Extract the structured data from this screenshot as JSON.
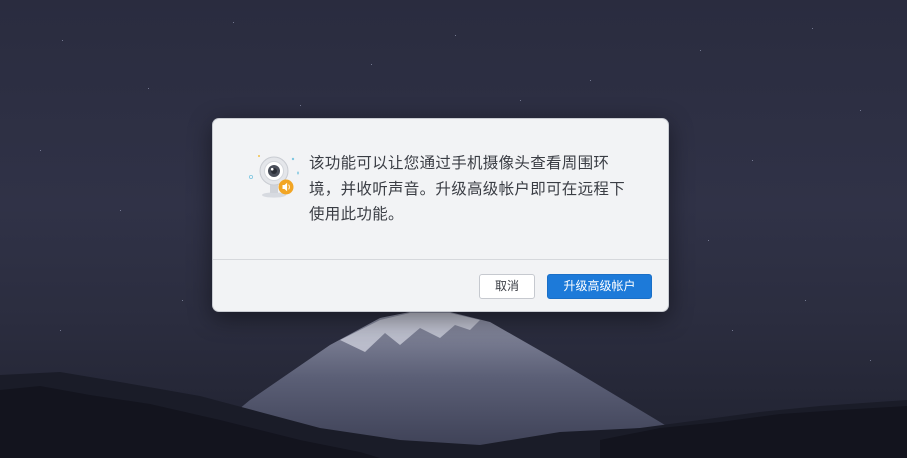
{
  "dialog": {
    "icon": "webcam-speaker-icon",
    "message": "该功能可以让您通过手机摄像头查看周围环境，并收听声音。升级高级帐户即可在远程下使用此功能。",
    "buttons": {
      "cancel_label": "取消",
      "upgrade_label": "升级高级帐户"
    }
  },
  "colors": {
    "primary_button": "#1d7ad9",
    "dialog_background": "#f2f3f5",
    "wallpaper_sky": "#2e3044",
    "icon_badge": "#f2a524"
  }
}
